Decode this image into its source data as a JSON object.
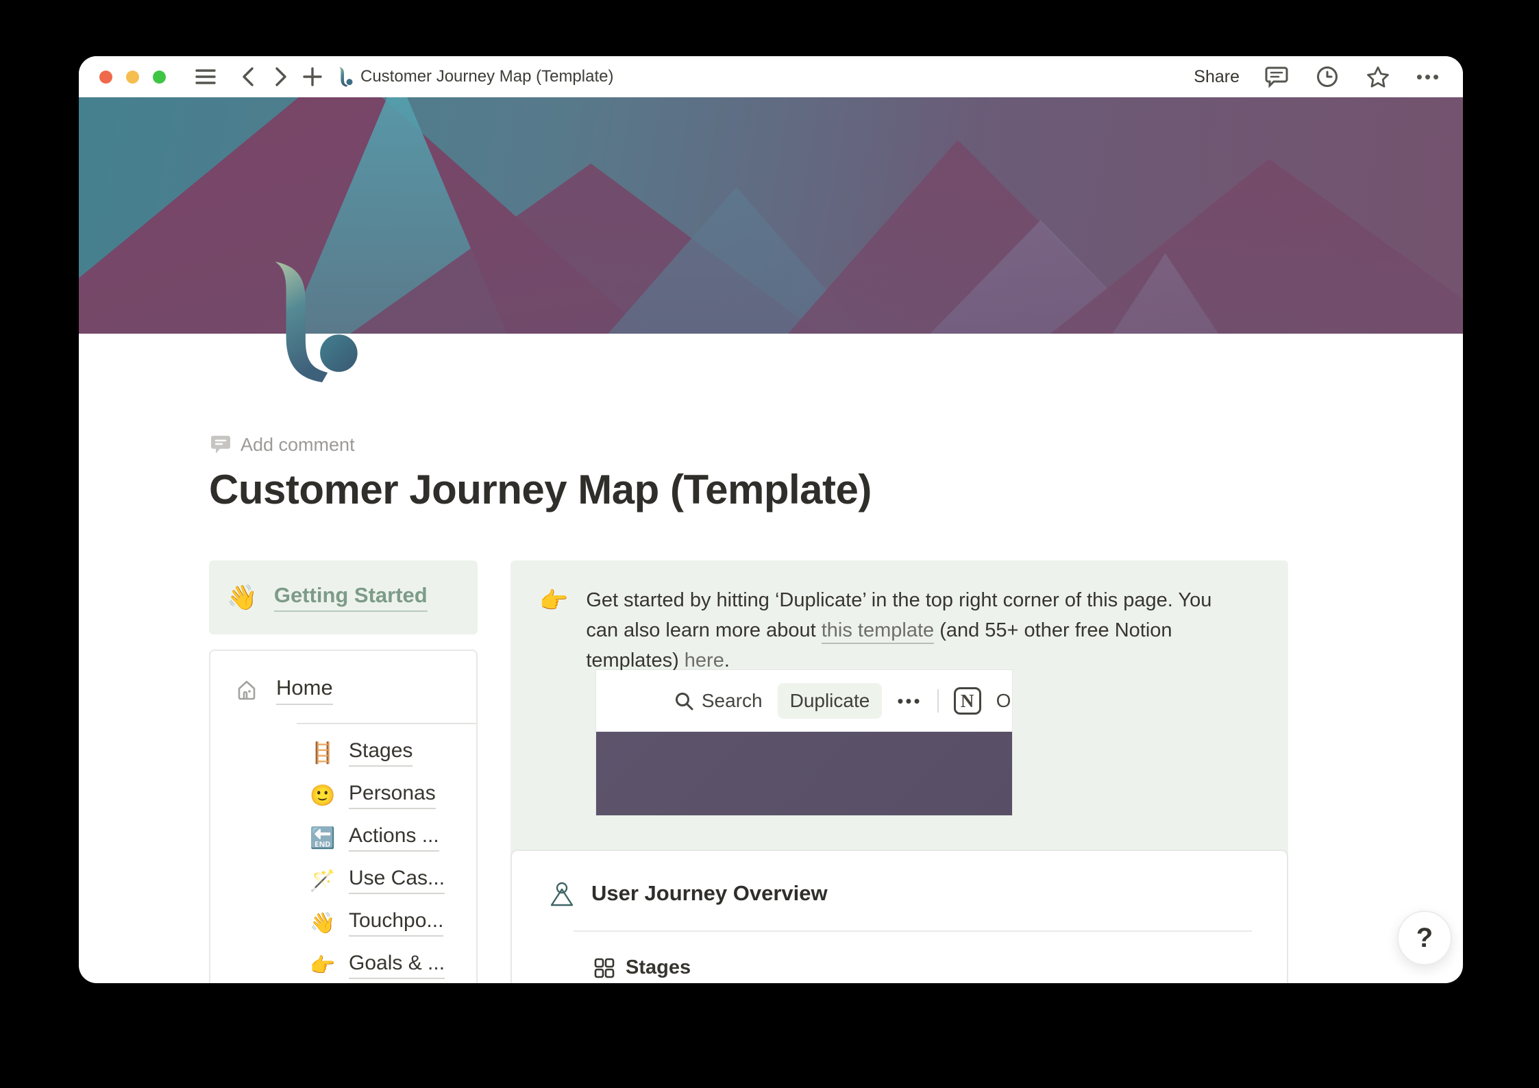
{
  "titlebar": {
    "title": "Customer Journey Map (Template)",
    "share_label": "Share",
    "ellipsis": "•••"
  },
  "page": {
    "add_comment_label": "Add comment",
    "title": "Customer Journey Map (Template)",
    "getting_started": {
      "icon": "👋",
      "label": "Getting Started"
    },
    "nav_box": {
      "home": {
        "label": "Home"
      },
      "items": [
        {
          "icon": "🪜",
          "label": "Stages"
        },
        {
          "icon": "🙂",
          "label": "Personas"
        },
        {
          "icon": "🔚",
          "label": "Actions ..."
        },
        {
          "icon": "🪄",
          "label": "Use Cas..."
        },
        {
          "icon": "👋",
          "label": "Touchpo..."
        },
        {
          "icon": "👉",
          "label": "Goals & ..."
        }
      ]
    },
    "callout": {
      "icon": "👉",
      "text_part1": "Get started by hitting ‘Duplicate’ in the top right corner of this page. You can also learn more about ",
      "link1": "this template",
      "text_part2": " (and 55+ other free Notion templates) ",
      "link2": "here",
      "text_part3": "."
    },
    "embed": {
      "search_label": "Search",
      "duplicate_label": "Duplicate",
      "ellipsis": "•••",
      "notion_letter": "N",
      "open_label": "Op"
    },
    "overview_card": {
      "title": "User Journey Overview",
      "tab_label": "Stages"
    },
    "help_label": "?"
  },
  "colors": {
    "traffic_red": "#ef6a4c",
    "traffic_yellow": "#f6bd4f",
    "traffic_green": "#3ec544",
    "callout_bg": "#edf3ec",
    "getting_started_text": "#7d9b88",
    "embed_purple": "#5c536b",
    "ink": "#37352f"
  }
}
